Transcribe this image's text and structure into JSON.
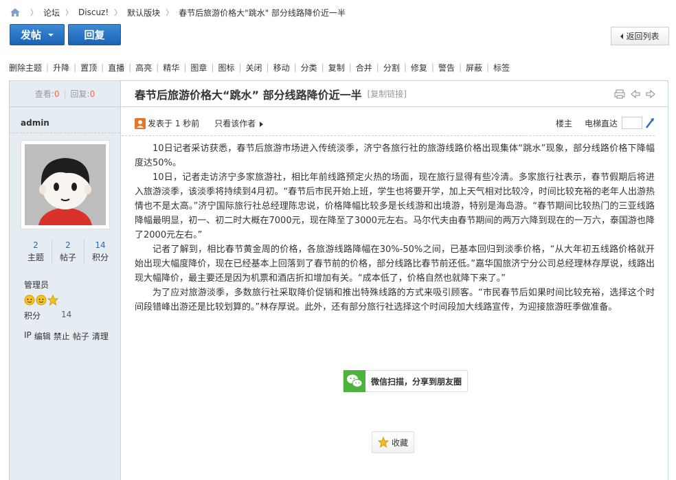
{
  "breadcrumb": {
    "items": [
      "论坛",
      "Discuz!",
      "默认版块",
      "春节后旅游价格大\"跳水\" 部分线路降价近一半"
    ]
  },
  "actions": {
    "post_label": "发帖",
    "reply_label": "回复",
    "back_label": "返回列表"
  },
  "modbar": {
    "items": [
      "删除主题",
      "升降",
      "置顶",
      "直播",
      "高亮",
      "精华",
      "图章",
      "图标",
      "关闭",
      "移动",
      "分类",
      "复制",
      "合并",
      "分割",
      "修复",
      "警告",
      "屏蔽",
      "标签"
    ]
  },
  "sidebar": {
    "views_label": "查看:",
    "views": "0",
    "replies_label": "回复:",
    "replies": "0",
    "author": "admin",
    "stats": [
      {
        "value": "2",
        "label": "主题"
      },
      {
        "value": "2",
        "label": "帖子"
      },
      {
        "value": "14",
        "label": "积分"
      }
    ],
    "group": "管理员",
    "points_label": "积分",
    "points": "14",
    "links": [
      "IP",
      "编辑",
      "禁止",
      "帖子",
      "清理"
    ]
  },
  "post": {
    "title": "春节后旅游价格大“跳水” 部分线路降价近一半",
    "copy_link": "[复制链接]",
    "posted": "发表于 1 秒前",
    "only_author": "只看该作者",
    "floor": "楼主",
    "jump": "电梯直达",
    "paragraphs": [
      "10日记者采访获悉，春节后旅游市场进入传统淡季，济宁各旅行社的旅游线路价格出现集体“跳水”现象，部分线路价格下降幅度达50%。",
      "10日，记者走访济宁多家旅游社，相比年前线路预定火热的场面，现在旅行显得有些冷清。多家旅行社表示，春节假期后将进入旅游淡季，该淡季将持续到4月初。“春节后市民开始上班，学生也将要开学，加上天气相对比较冷，时间比较充裕的老年人出游热情也不是太高。”济宁国际旅行社总经理陈忠说，价格降幅比较多是长线游和出境游，特别是海岛游。“春节期间比较热门的三亚线路降幅最明显，初一、初二时大概在7000元，现在降至了3000元左右。马尔代夫由春节期间的两万六降到现在的一万六，泰国游也降了2000元左右。”",
      "记者了解到，相比春节黄金周的价格，各旅游线路降幅在30%-50%之间，已基本回归到淡季价格，“从大年初五线路价格就开始出现大幅度降价，现在已经基本上回落到了春节前的价格，部分线路比春节前还低。”嘉华国旅济宁分公司总经理林存厚说，线路出现大幅降价，最主要还是因为机票和酒店折扣增加有关。“成本低了，价格自然也就降下来了。”",
      "为了应对旅游淡季，多数旅行社采取降价促销和推出特殊线路的方式来吸引顾客。“市民春节后如果时间比较充裕，选择这个时间段错峰出游还是比较划算的。”林存厚说。此外，还有部分旅行社选择这个时间段加大线路宣传，为迎接旅游旺季做准备。"
    ],
    "wechat_label": "微信扫描，分享到朋友圈",
    "favorite_label": "收藏"
  }
}
